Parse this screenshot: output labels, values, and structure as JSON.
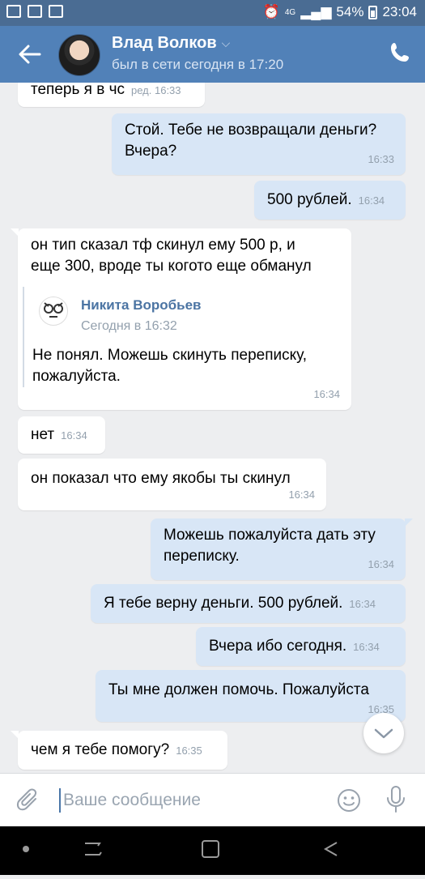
{
  "status_bar": {
    "network": "4G",
    "battery": "54%",
    "time": "23:04"
  },
  "header": {
    "name": "Влад Волков",
    "last_seen": "был в сети сегодня в 17:20"
  },
  "messages": [
    {
      "text": "теперь я в чс",
      "time": "ред. 16:33"
    },
    {
      "line1": "Стой. Тебе не возвращали деньги?",
      "line2": "Вчера?",
      "time": "16:33"
    },
    {
      "text": "500 рублей.",
      "time": "16:34"
    },
    {
      "line1": "он тип сказал тф скинул ему 500 р, и",
      "line2": "еще 300, вроде ты когото еще обманул",
      "time": "16:34",
      "forward": {
        "name": "Никита Воробьев",
        "date": "Сегодня в 16:32",
        "line1": "Не понял. Можешь скинуть переписку,",
        "line2": "пожалуйста."
      }
    },
    {
      "text": "нет",
      "time": "16:34"
    },
    {
      "text": "он показал что ему якобы ты скинул",
      "time": "16:34"
    },
    {
      "line1": "Можешь пожалуйста дать эту",
      "line2": "переписку.",
      "time": "16:34"
    },
    {
      "text": "Я тебе верну деньги. 500 рублей.",
      "time": "16:34"
    },
    {
      "text": "Вчера ибо сегодня.",
      "time": "16:34"
    },
    {
      "text": "Ты мне должен помочь. Пожалуйста",
      "time": "16:35"
    },
    {
      "text": "чем я тебе помогу?",
      "time": "16:35"
    }
  ],
  "composer": {
    "placeholder": "Ваше сообщение"
  },
  "colors": {
    "header": "#5181b8",
    "status_bar": "#4a6c93",
    "outgoing_bubble": "#d8e6f6",
    "incoming_bubble": "#ffffff",
    "background": "#edeef0"
  }
}
